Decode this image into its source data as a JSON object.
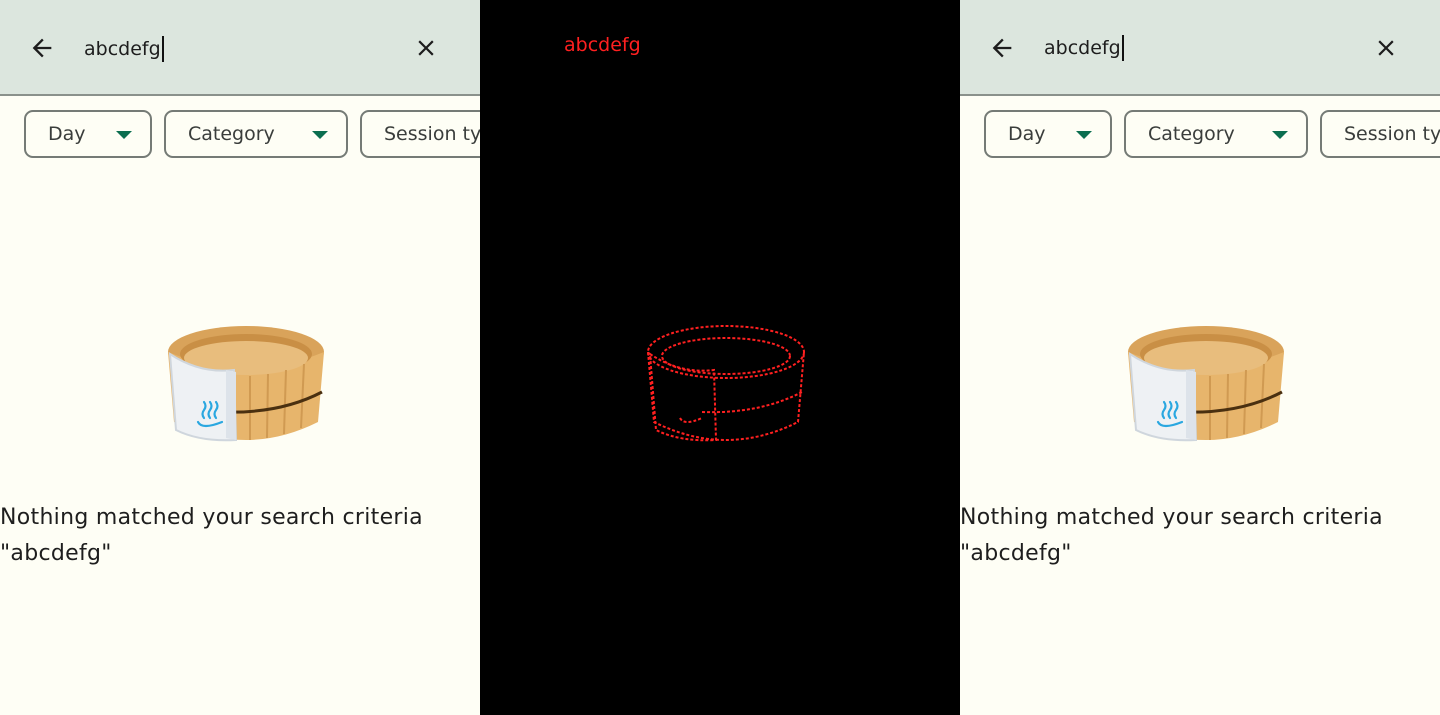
{
  "search": {
    "query": "abcdefg",
    "back_icon": "arrow-back-icon",
    "clear_icon": "close-icon"
  },
  "filters": [
    {
      "label": "Day"
    },
    {
      "label": "Category"
    },
    {
      "label": "Session type"
    }
  ],
  "empty_state": {
    "image": "wooden-bath-bucket-with-towel-image",
    "line1": "Nothing matched your search criteria",
    "line2": "\"abcdefg\""
  },
  "diff_overlay": {
    "query_text": "abcdefg"
  },
  "colors": {
    "topbar_bg": "#dce6de",
    "page_bg": "#fefef5",
    "accent": "#0b6e4f",
    "diff_red": "#ff2020"
  }
}
